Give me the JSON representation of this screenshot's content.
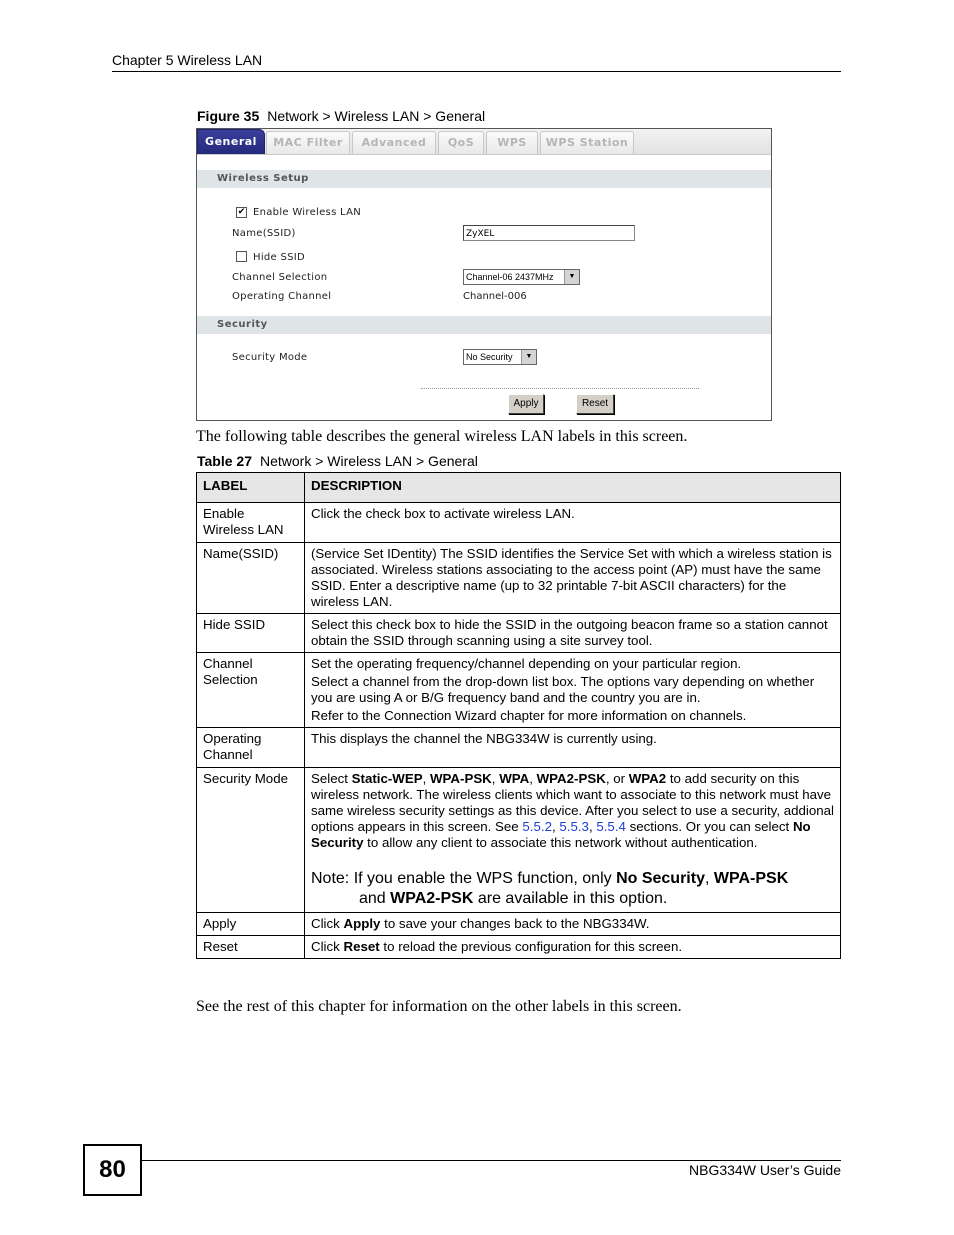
{
  "header": {
    "chapter": "Chapter 5 Wireless LAN"
  },
  "figure": {
    "label": "Figure 35",
    "title": "Network > Wireless LAN > General"
  },
  "screen": {
    "tabs": [
      {
        "label": "General",
        "active": true
      },
      {
        "label": "MAC Filter",
        "active": false
      },
      {
        "label": "Advanced",
        "active": false
      },
      {
        "label": "QoS",
        "active": false
      },
      {
        "label": "WPS",
        "active": false
      },
      {
        "label": "WPS Station",
        "active": false
      }
    ],
    "wireless_setup": {
      "title": "Wireless Setup",
      "enable_wlan": {
        "label": "Enable Wireless LAN",
        "checked": true
      },
      "ssid": {
        "label": "Name(SSID)",
        "value": "ZyXEL"
      },
      "hide_ssid": {
        "label": "Hide SSID",
        "checked": false
      },
      "channel_selection": {
        "label": "Channel Selection",
        "value": "Channel-06 2437MHz"
      },
      "operating_channel": {
        "label": "Operating Channel",
        "value": "Channel-006"
      }
    },
    "security": {
      "title": "Security",
      "mode": {
        "label": "Security Mode",
        "value": "No Security"
      }
    },
    "buttons": {
      "apply": "Apply",
      "reset": "Reset"
    },
    "check_mark": "✔",
    "dropdown_arrow": "▼"
  },
  "intro_text": "The following table describes the general wireless LAN labels in this screen.",
  "table": {
    "label": "Table 27",
    "title": "Network > Wireless LAN > General",
    "headers": [
      "LABEL",
      "DESCRIPTION"
    ],
    "rows": [
      {
        "label": "Enable Wireless LAN",
        "desc": "Click the check box to activate wireless LAN."
      },
      {
        "label": "Name(SSID)",
        "desc": "(Service Set IDentity) The SSID identifies the Service Set with which a wireless station is associated. Wireless stations associating to the access point (AP) must have the same SSID. Enter a descriptive name (up to 32 printable 7-bit ASCII characters) for the wireless LAN."
      },
      {
        "label": "Hide SSID",
        "desc": "Select this check box to hide the SSID in the outgoing beacon frame so a station cannot obtain the SSID through scanning using a site survey tool."
      },
      {
        "label": "Channel Selection",
        "desc_paragraphs": [
          "Set the operating frequency/channel depending on your particular region.",
          "Select a channel from the drop-down list box. The options vary depending on whether you are using A or B/G frequency band and the country you are in.",
          "Refer to the Connection Wizard chapter for more information on channels."
        ]
      },
      {
        "label": "Operating Channel",
        "desc": "This displays the channel the NBG334W is currently using."
      },
      {
        "label": "Security Mode",
        "desc_parts": {
          "p1": "Select ",
          "b1": "Static-WEP",
          "p2": ", ",
          "b2": "WPA-PSK",
          "p3": ", ",
          "b3": "WPA",
          "p4": ", ",
          "b4": "WPA2-PSK",
          "p5": ", or ",
          "b5": "WPA2",
          "p6": " to add security on this wireless network. The wireless clients which want to associate to this network must have same wireless security settings as this device. After you select to use a security, addional options appears in this screen. See ",
          "l1": "5.5.2",
          "p7": ", ",
          "l2": "5.5.3",
          "p8": ", ",
          "l3": "5.5.4",
          "p9": " sections. Or you can select ",
          "b6": "No Security",
          "p10": " to allow any client to associate this network without authentication."
        },
        "note_parts": {
          "n1": "Note: If you enable the WPS function, only ",
          "nb1": "No Security",
          "n2": ", ",
          "nb2": "WPA-PSK",
          "n3": "and ",
          "nb3": "WPA2-PSK",
          "n4": " are available in this option."
        }
      },
      {
        "label": "Apply",
        "desc_parts": {
          "p1": "Click ",
          "b1": "Apply",
          "p2": " to save your changes back to the NBG334W."
        }
      },
      {
        "label": "Reset",
        "desc_parts": {
          "p1": "Click ",
          "b1": "Reset",
          "p2": " to reload the previous configuration for this screen."
        }
      }
    ]
  },
  "outro_text": "See the rest of this chapter for information on the other labels in this screen.",
  "footer": {
    "page_number": "80",
    "guide_title": "NBG334W User’s Guide"
  }
}
